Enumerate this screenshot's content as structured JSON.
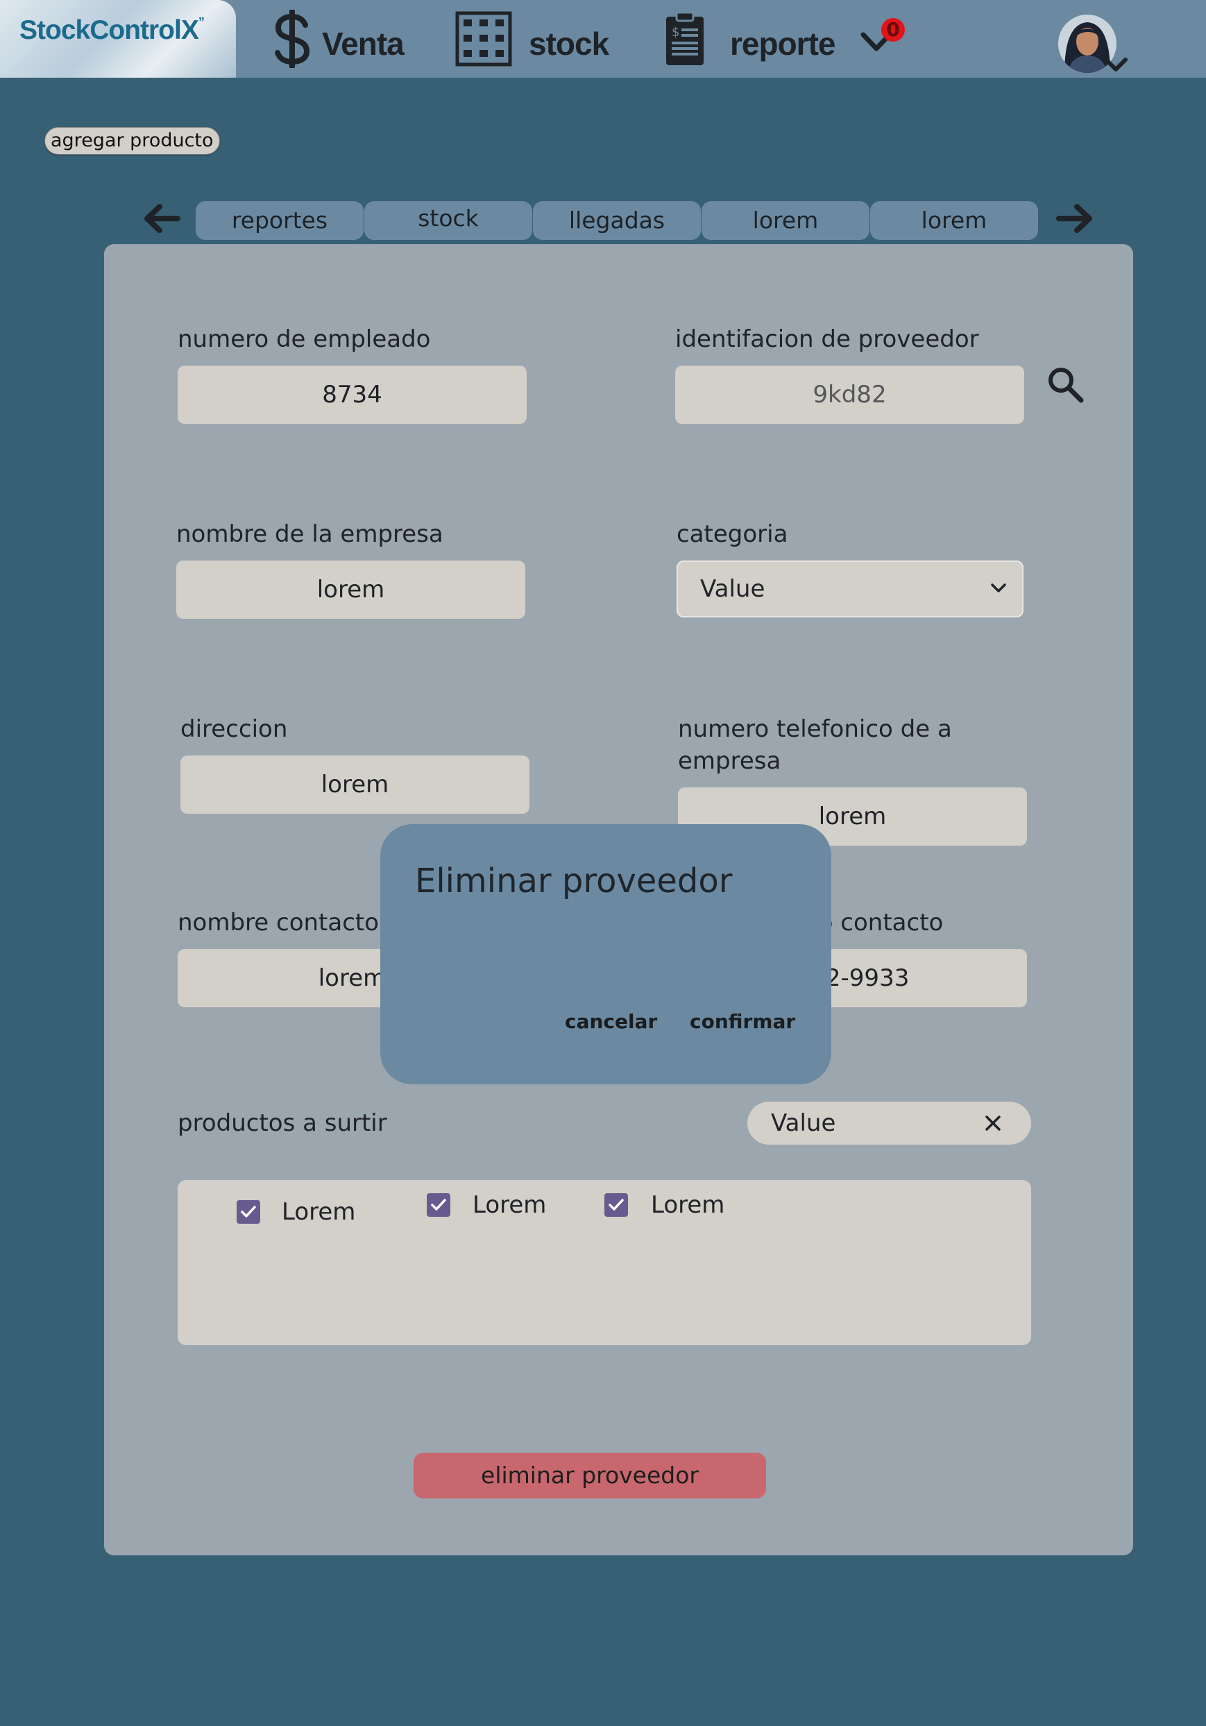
{
  "app": {
    "logo_text": "StockControlX",
    "logo_mark": "”"
  },
  "nav": {
    "items": [
      {
        "label": "Venta",
        "icon": "dollar-icon"
      },
      {
        "label": "stock",
        "icon": "shelves-icon"
      },
      {
        "label": "reporte",
        "icon": "clipboard-icon"
      }
    ],
    "notification_count": "0"
  },
  "toolbar": {
    "add_product_label": "agregar producto"
  },
  "tabs": [
    {
      "label": "reportes"
    },
    {
      "label": "stock"
    },
    {
      "label": "llegadas"
    },
    {
      "label": "lorem"
    },
    {
      "label": "lorem"
    }
  ],
  "form": {
    "employee_number": {
      "label": "numero de empleado",
      "value": "8734"
    },
    "supplier_id": {
      "label": "identifacion de proveedor",
      "value": "9kd82"
    },
    "company_name": {
      "label": "nombre de la empresa",
      "value": "lorem"
    },
    "category": {
      "label": "categoria",
      "value": "Value"
    },
    "address": {
      "label": "direccion",
      "value": "lorem"
    },
    "company_phone": {
      "label_line1": "numero telefonico de a",
      "label_line2": "empresa",
      "value": "lorem"
    },
    "contact_name": {
      "label": "nombre contacto c",
      "value": "lorem"
    },
    "contact_phone": {
      "label": "nico contacto",
      "value": "932-9933"
    },
    "products": {
      "label": "productos a surtir",
      "chip_value": "Value",
      "items": [
        {
          "label": "Lorem",
          "checked": true
        },
        {
          "label": "Lorem",
          "checked": true
        },
        {
          "label": "Lorem",
          "checked": true
        }
      ]
    },
    "delete_label": "eliminar proveedor"
  },
  "modal": {
    "title": "Eliminar proveedor",
    "cancel_label": "cancelar",
    "confirm_label": "confirmar"
  },
  "colors": {
    "background": "#386075",
    "header": "#6b8aa2",
    "panel": "#9ca6af",
    "field": "#d3cfc9",
    "danger": "#c8676d",
    "checkbox": "#675a8f",
    "badge": "#e0141b"
  }
}
